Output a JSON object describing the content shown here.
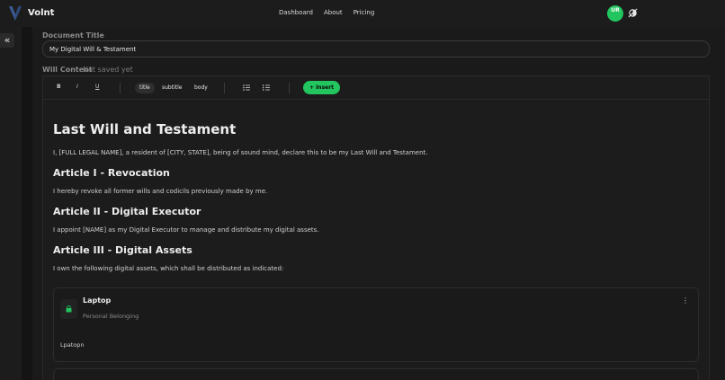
{
  "app": {
    "brand": "Volnt",
    "nav": [
      "Dashboard",
      "About",
      "Pricing"
    ],
    "avatar_initials": "UR",
    "accent": "#22c55e"
  },
  "form": {
    "title_label": "Document Title",
    "title_value": "My Digital Will & Testament",
    "content_label": "Will Content",
    "save_status": "Not saved yet"
  },
  "toolbar": {
    "bold": "B",
    "italic": "I",
    "underline": "U",
    "styles": [
      "title",
      "subtitle",
      "body"
    ],
    "active_style": "title",
    "insert_label": "Insert"
  },
  "document": {
    "heading": "Last Will and Testament",
    "intro": "I, [FULL LEGAL NAME], a resident of [CITY, STATE], being of sound mind, declare this to be my Last Will and Testament.",
    "sections": [
      {
        "title": "Article I - Revocation",
        "body": "I hereby revoke all former wills and codicils previously made by me."
      },
      {
        "title": "Article II - Digital Executor",
        "body": "I appoint [NAME] as my Digital Executor to manage and distribute my digital assets."
      },
      {
        "title": "Article III - Digital Assets",
        "body": "I own the following digital assets, which shall be distributed as indicated:"
      }
    ]
  },
  "asset": {
    "name": "Laptop",
    "category": "Personal Belonging",
    "description": "Lpatopn"
  }
}
